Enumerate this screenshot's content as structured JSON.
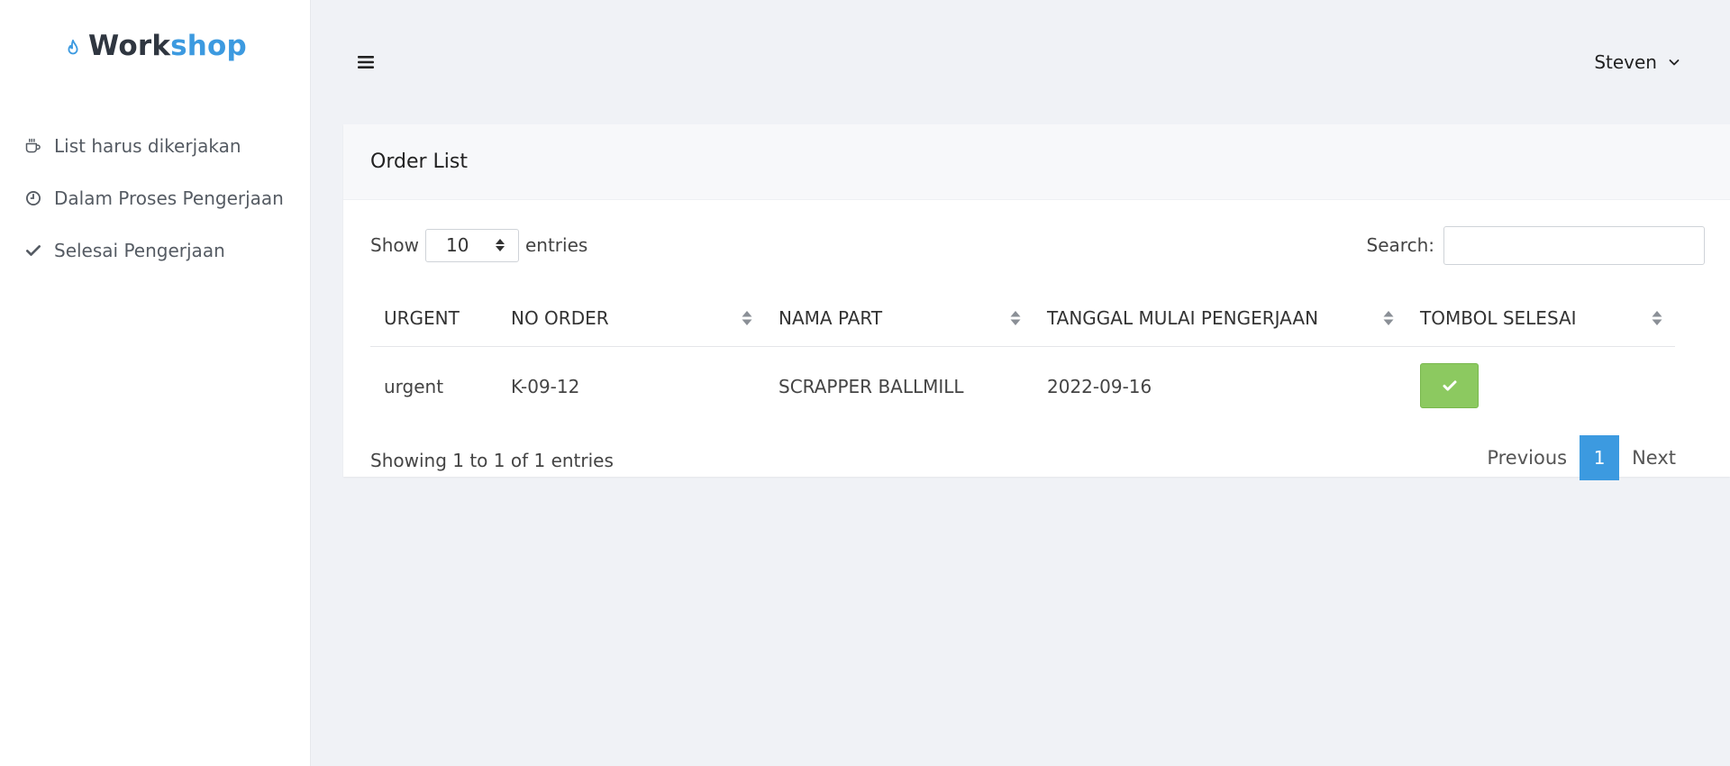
{
  "brand": {
    "part1": "Work",
    "part2": "shop",
    "icon": "flame-icon"
  },
  "sidebar": {
    "items": [
      {
        "label": "List harus dikerjakan",
        "icon": "coffee-cup-icon"
      },
      {
        "label": "Dalam Proses Pengerjaan",
        "icon": "clock-icon"
      },
      {
        "label": "Selesai Pengerjaan",
        "icon": "check-icon"
      }
    ]
  },
  "topbar": {
    "menu_icon": "hamburger-icon",
    "user_name": "Steven",
    "user_icon": "chevron-down-icon"
  },
  "card": {
    "title": "Order List",
    "length": {
      "show_label": "Show",
      "value": "10",
      "entries_label": "entries"
    },
    "search": {
      "label": "Search:",
      "value": "",
      "placeholder": ""
    },
    "table": {
      "columns": [
        "URGENT",
        "NO ORDER",
        "NAMA PART",
        "TANGGAL MULAI PENGERJAAN",
        "TOMBOL SELESAI"
      ],
      "rows": [
        {
          "urgent": "urgent",
          "no_order": "K-09-12",
          "nama_part": "SCRAPPER BALLMILL",
          "tanggal": "2022-09-16",
          "action_icon": "check-icon"
        }
      ]
    },
    "info": "Showing 1 to 1 of 1 entries",
    "pagination": {
      "previous": "Previous",
      "page": "1",
      "next": "Next"
    }
  },
  "colors": {
    "accent": "#3c9ae0",
    "success": "#8cc960",
    "background": "#f0f2f6"
  }
}
